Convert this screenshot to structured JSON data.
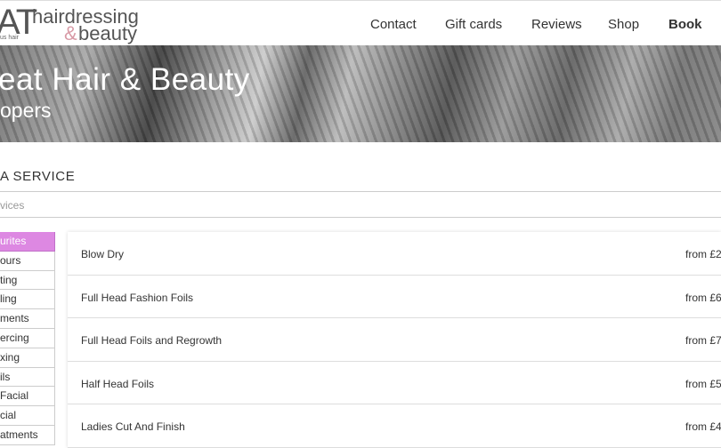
{
  "logo": {
    "letters": "AT",
    "tagline": "us hair",
    "line1": "hairdressing",
    "amp": "&",
    "line2": "beauty"
  },
  "nav": [
    "Contact",
    "Gift cards",
    "Reviews",
    "Shop",
    "Book"
  ],
  "banner": {
    "title": "eat Hair & Beauty",
    "subtitle": "opers"
  },
  "section_title": "A SERVICE",
  "search": {
    "placeholder": "vices"
  },
  "categories": [
    {
      "label": "urites",
      "active": true
    },
    {
      "label": "ours"
    },
    {
      "label": "ting"
    },
    {
      "label": "ling"
    },
    {
      "label": "ments"
    },
    {
      "label": "ercing"
    },
    {
      "label": "xing"
    },
    {
      "label": "ils"
    },
    {
      "label": " Facial"
    },
    {
      "label": "cial"
    },
    {
      "label": "atments"
    }
  ],
  "services": [
    {
      "name": "Blow Dry",
      "price": "from £2"
    },
    {
      "name": "Full Head Fashion Foils",
      "price": "from £6"
    },
    {
      "name": "Full Head Foils and Regrowth",
      "price": "from £7"
    },
    {
      "name": "Half Head Foils",
      "price": "from £5"
    },
    {
      "name": "Ladies Cut And Finish",
      "price": "from £4"
    }
  ],
  "colors": {
    "active_category": "#dd88e2",
    "logo_amp": "#d89aa6"
  }
}
